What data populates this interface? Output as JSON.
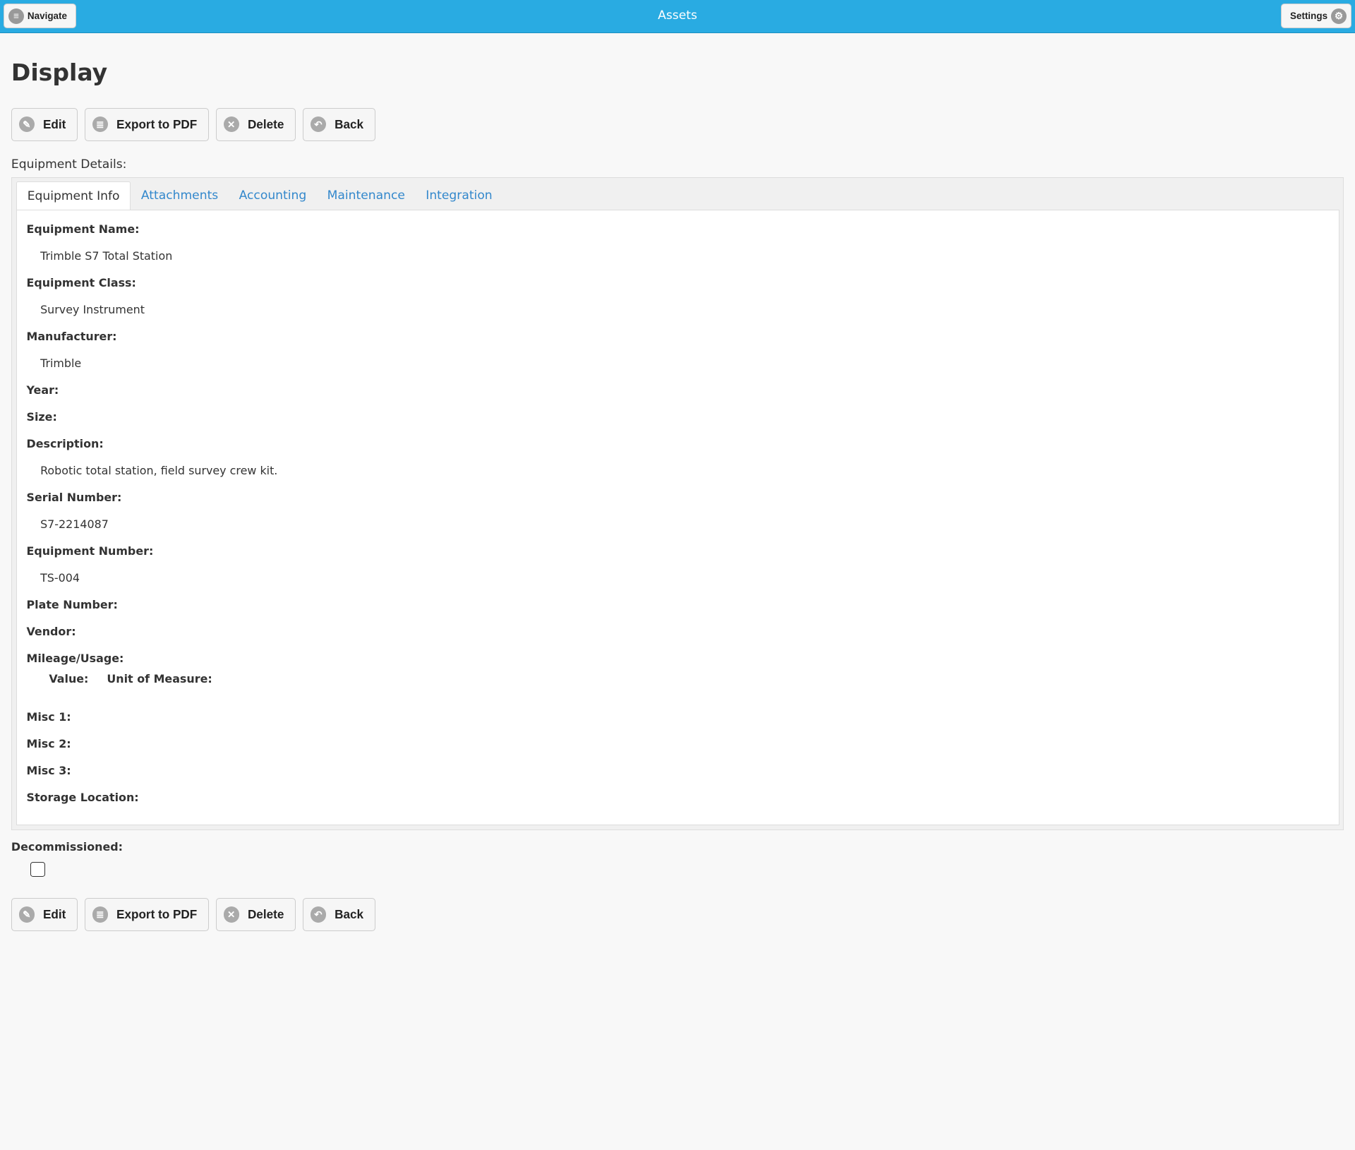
{
  "header": {
    "title": "Assets",
    "navigate_label": "Navigate",
    "settings_label": "Settings",
    "navigate_icon": "menu-icon",
    "settings_icon": "gear-icon"
  },
  "page": {
    "title": "Display"
  },
  "actions": {
    "edit": "Edit",
    "export": "Export to PDF",
    "delete": "Delete",
    "back": "Back"
  },
  "equipment_details_label": "Equipment Details:",
  "tabs": [
    {
      "label": "Equipment Info",
      "active": true
    },
    {
      "label": "Attachments",
      "active": false
    },
    {
      "label": "Accounting",
      "active": false
    },
    {
      "label": "Maintenance",
      "active": false
    },
    {
      "label": "Integration",
      "active": false
    }
  ],
  "fields": {
    "equipment_name": {
      "label": "Equipment Name:",
      "value": "Trimble S7 Total Station"
    },
    "equipment_class": {
      "label": "Equipment Class:",
      "value": "Survey Instrument"
    },
    "manufacturer": {
      "label": "Manufacturer:",
      "value": "Trimble"
    },
    "year": {
      "label": "Year:",
      "value": ""
    },
    "size": {
      "label": "Size:",
      "value": ""
    },
    "description": {
      "label": "Description:",
      "value": "Robotic total station, field survey crew kit."
    },
    "serial_number": {
      "label": "Serial Number:",
      "value": "S7-2214087"
    },
    "equipment_number": {
      "label": "Equipment Number:",
      "value": "TS-004"
    },
    "plate_number": {
      "label": "Plate Number:",
      "value": ""
    },
    "vendor": {
      "label": "Vendor:",
      "value": ""
    },
    "mileage": {
      "label": "Mileage/Usage:",
      "value_label": "Value:",
      "unit_label": "Unit of Measure:"
    },
    "misc1": {
      "label": "Misc 1:",
      "value": ""
    },
    "misc2": {
      "label": "Misc 2:",
      "value": ""
    },
    "misc3": {
      "label": "Misc 3:",
      "value": ""
    },
    "storage_location": {
      "label": "Storage Location:",
      "value": ""
    }
  },
  "decommissioned": {
    "label": "Decommissioned:",
    "checked": false
  },
  "colors": {
    "header_bg": "#29abe2",
    "tab_link": "#3388cc"
  }
}
